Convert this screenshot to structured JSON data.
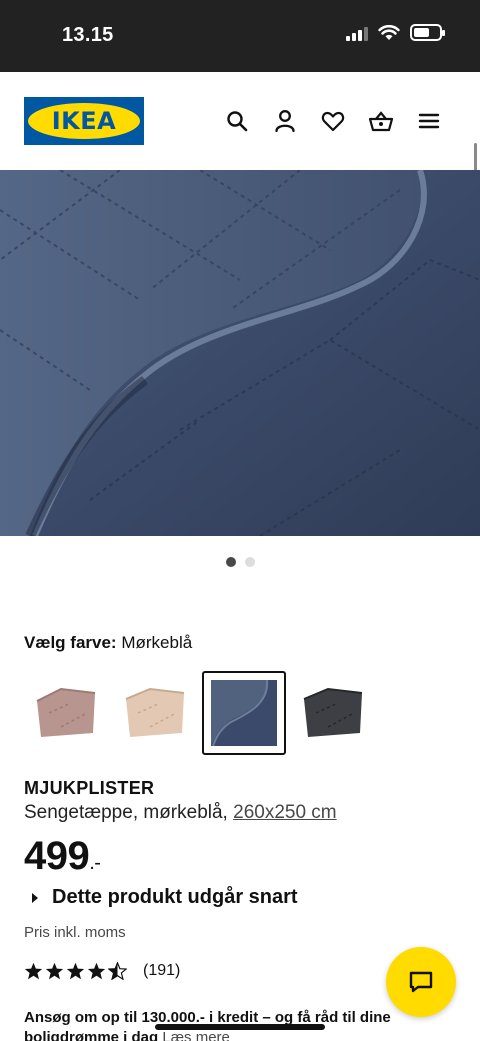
{
  "status_bar": {
    "time": "13.15"
  },
  "header": {
    "logo_text": "IKEA",
    "icons": [
      "search-icon",
      "account-icon",
      "heart-icon",
      "basket-icon",
      "menu-icon"
    ]
  },
  "gallery": {
    "image_count": 2,
    "active_index": 0
  },
  "color_picker": {
    "label": "Vælg farve:",
    "selected_value": "Mørkeblå",
    "swatches": [
      {
        "color": "#b8958f",
        "selected": false
      },
      {
        "color": "#e3c9b4",
        "selected": false
      },
      {
        "color": "#3b4a6a",
        "selected": true
      },
      {
        "color": "#3d3f44",
        "selected": false
      }
    ]
  },
  "product": {
    "name": "MJUKPLISTER",
    "description": "Sengetæppe, mørkeblå,",
    "size_link": "260x250 cm",
    "price": "499",
    "price_suffix": ".-",
    "discontinued_notice": "Dette produkt udgår snart",
    "vat_note": "Pris inkl. moms",
    "rating": 4.5,
    "rating_count": "(191)"
  },
  "credit": {
    "text": "Ansøg om op til 130.000.- i kredit – og få råd til dine boligdrømme i dag",
    "link": "Læs mere"
  },
  "colors": {
    "ikea_blue": "#0058a3",
    "ikea_yellow": "#ffdb00",
    "status_bar": "#222222"
  }
}
